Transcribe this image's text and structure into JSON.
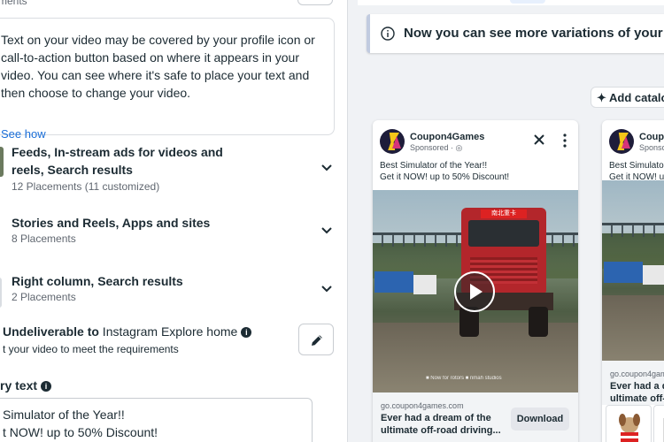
{
  "left": {
    "top_cut_text": "ments",
    "tip": {
      "text": "Text on your video may be covered by your profile icon or call-to-action button based on where it appears in your video. You can see where it's safe to place your text and then choose to change your video.",
      "link": "See how"
    },
    "groups": [
      {
        "title": "Feeds, In-stream ads for videos and reels, Search results",
        "sub": "12 Placements (11 customized)"
      },
      {
        "title": "Stories and Reels, Apps and sites",
        "sub": "8 Placements"
      },
      {
        "title": "Right column, Search results",
        "sub": "2 Placements"
      }
    ],
    "undeliverable": {
      "bold": "Undeliverable to",
      "rest": " Instagram Explore home",
      "sub": "t your video to meet the requirements"
    },
    "primary_text": {
      "label": "ry text",
      "value": "Simulator of the Year!!\nt NOW! up to 50% Discount!"
    }
  },
  "right": {
    "notice": "Now you can see more variations of your a",
    "add_catalog": "Add catalo",
    "card1": {
      "page_name": "Coupon4Games",
      "sponsored": "Sponsored · ◎",
      "ad_text": "Best Simulator of the Year!!\nGet it NOW! up to 50% Discount!",
      "truck_sign": "南北重卡",
      "video_logos": "■ Now for rotors    ■ nmah studios",
      "domain": "go.coupon4games.com",
      "headline": "Ever had a dream of the ultimate off-road driving...",
      "cta": "Download"
    },
    "card2": {
      "page_name": "Coupon",
      "sponsored": "Sponsore",
      "ad_text": "Best Simulator\nGet it NOW! u",
      "domain": "go.coupon4gams",
      "headline": "Ever had a dr ultimate off-ro"
    }
  }
}
